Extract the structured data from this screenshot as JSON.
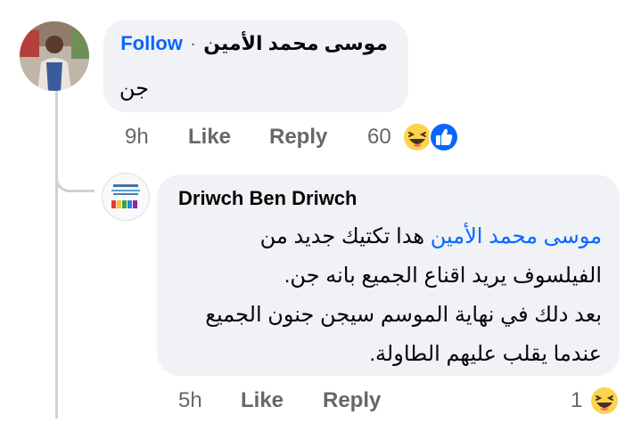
{
  "comment1": {
    "author": "موسى محمد الأمين",
    "separator": "·",
    "follow_label": "Follow",
    "text": "جن",
    "time": "9h",
    "like_label": "Like",
    "reply_label": "Reply",
    "reaction_count": "60",
    "reaction_icons": [
      "haha-emoji-icon",
      "like-thumb-icon"
    ],
    "colors": {
      "link": "#0866ff",
      "bubble": "#f0f2f5",
      "meta": "#65676b"
    }
  },
  "reply1": {
    "author": "Driwch Ben Driwch",
    "mention": "موسى محمد الأمين",
    "line1_rest": "هدا تكتيك جديد من",
    "line2": "الفيلسوف يريد اقناع الجميع بانه جن.",
    "line3": "بعد دلك في نهاية الموسم سيجن جنون الجميع",
    "line4": "عندما يقلب عليهم الطاولة.",
    "time": "5h",
    "like_label": "Like",
    "reply_label": "Reply",
    "reaction_count": "1",
    "reaction_icons": [
      "haha-emoji-icon"
    ]
  }
}
